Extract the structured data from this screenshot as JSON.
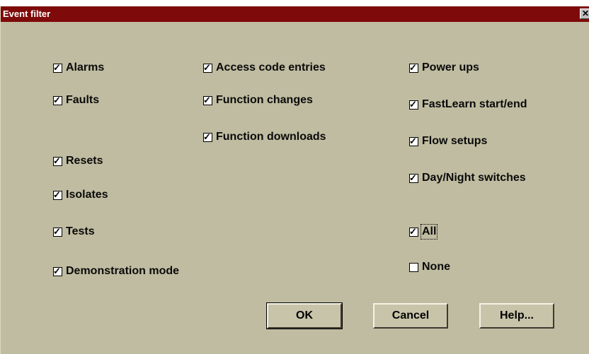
{
  "window": {
    "title": "Event filter",
    "close_glyph": "✕"
  },
  "checkboxes": {
    "col1": [
      {
        "label": "Alarms",
        "checked": true
      },
      {
        "label": "Faults",
        "checked": true
      },
      {
        "label": "Resets",
        "checked": true
      },
      {
        "label": "Isolates",
        "checked": true
      },
      {
        "label": "Tests",
        "checked": true
      },
      {
        "label": "Demonstration mode",
        "checked": true
      }
    ],
    "col2": [
      {
        "label": "Access code entries",
        "checked": true
      },
      {
        "label": "Function changes",
        "checked": true
      },
      {
        "label": "Function downloads",
        "checked": true
      }
    ],
    "col3": [
      {
        "label": "Power ups",
        "checked": true
      },
      {
        "label": "FastLearn start/end",
        "checked": true
      },
      {
        "label": "Flow setups",
        "checked": true
      },
      {
        "label": "Day/Night switches",
        "checked": true
      },
      {
        "label": "All",
        "checked": true
      },
      {
        "label": "None",
        "checked": false
      }
    ]
  },
  "buttons": {
    "ok": "OK",
    "cancel": "Cancel",
    "help": "Help..."
  },
  "colors": {
    "titlebar": "#7e0a0a",
    "dialog_bg": "#c0bca1"
  }
}
